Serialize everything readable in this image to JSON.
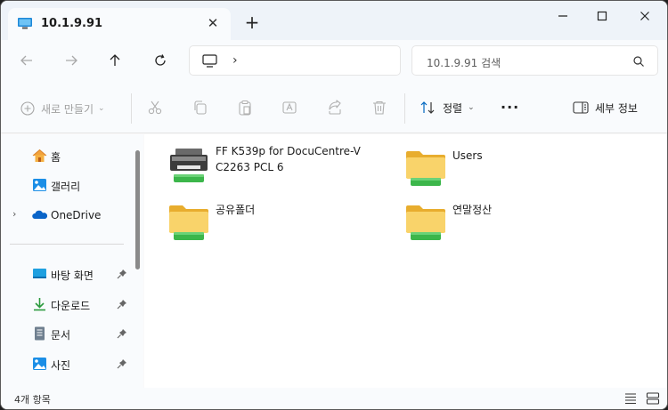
{
  "tab": {
    "title": "10.1.9.91",
    "close": "✕",
    "new_tab": "+"
  },
  "window_controls": {
    "minimize": "—",
    "maximize": "☐",
    "close": "✕"
  },
  "navigation": {
    "address_separator": "›",
    "search_placeholder": "10.1.9.91 검색"
  },
  "commandbar": {
    "new_label": "새로 만들기",
    "sort_label": "정렬",
    "more_label": "···",
    "details_label": "세부 정보"
  },
  "sidebar": {
    "items": [
      {
        "label": "홈",
        "icon": "home-icon"
      },
      {
        "label": "갤러리",
        "icon": "gallery-icon"
      },
      {
        "label": "OneDrive",
        "icon": "onedrive-icon",
        "expander": "›"
      },
      {
        "label": "바탕 화면",
        "icon": "desktop-icon",
        "pinned": true
      },
      {
        "label": "다운로드",
        "icon": "download-icon",
        "pinned": true
      },
      {
        "label": "문서",
        "icon": "documents-icon",
        "pinned": true
      },
      {
        "label": "사진",
        "icon": "pictures-icon",
        "pinned": true
      }
    ]
  },
  "files": [
    {
      "name": "FF K539p for DocuCentre-V C2263 PCL 6",
      "type": "printer"
    },
    {
      "name": "Users",
      "type": "folder"
    },
    {
      "name": "공유폴더",
      "type": "folder"
    },
    {
      "name": "연말정산",
      "type": "folder"
    }
  ],
  "status": {
    "item_count": "4개 항목"
  },
  "colors": {
    "accent": "#0067c0",
    "folder": "#f4c84b",
    "share_bar": "#3cb64b"
  }
}
